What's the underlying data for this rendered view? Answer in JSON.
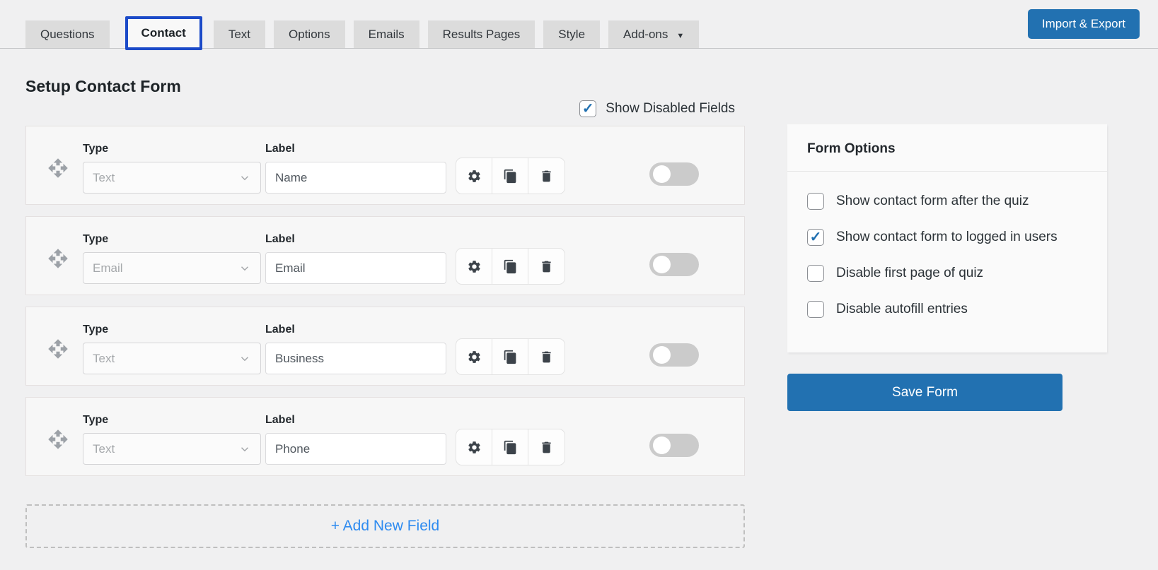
{
  "tabs": {
    "items": [
      {
        "label": "Questions",
        "active": false,
        "has_dropdown": false
      },
      {
        "label": "Contact",
        "active": true,
        "has_dropdown": false
      },
      {
        "label": "Text",
        "active": false,
        "has_dropdown": false
      },
      {
        "label": "Options",
        "active": false,
        "has_dropdown": false
      },
      {
        "label": "Emails",
        "active": false,
        "has_dropdown": false
      },
      {
        "label": "Results Pages",
        "active": false,
        "has_dropdown": false
      },
      {
        "label": "Style",
        "active": false,
        "has_dropdown": false
      },
      {
        "label": "Add-ons",
        "active": false,
        "has_dropdown": true
      }
    ],
    "import_export_label": "Import & Export"
  },
  "header": {
    "title": "Setup Contact Form",
    "show_disabled_label": "Show Disabled Fields",
    "show_disabled_checked": true
  },
  "fields": {
    "type_column_label": "Type",
    "label_column_label": "Label",
    "rows": [
      {
        "type": "Text",
        "label": "Name",
        "enabled": false
      },
      {
        "type": "Email",
        "label": "Email",
        "enabled": false
      },
      {
        "type": "Text",
        "label": "Business",
        "enabled": false
      },
      {
        "type": "Text",
        "label": "Phone",
        "enabled": false
      }
    ],
    "add_new_label": "+ Add New Field"
  },
  "form_options": {
    "title": "Form Options",
    "options": [
      {
        "label": "Show contact form after the quiz",
        "checked": false
      },
      {
        "label": "Show contact form to logged in users",
        "checked": true
      },
      {
        "label": "Disable first page of quiz",
        "checked": false
      },
      {
        "label": "Disable autofill entries",
        "checked": false
      }
    ],
    "save_label": "Save Form"
  },
  "icons": {
    "drag": "move-icon",
    "settings": "gear-icon",
    "duplicate": "copy-icon",
    "delete": "trash-icon",
    "select_arrow": "chevron-down-icon",
    "addons_arrow": "caret-down-icon",
    "checkbox_mark": "check-icon"
  },
  "colors": {
    "accent_blue": "#2271b1",
    "active_tab_border": "#1b4ac8",
    "add_field_link": "#2e8bf0",
    "toggle_off": "#cbcbcb",
    "page_background": "#f0f0f1",
    "tab_background": "#dcdcdc"
  }
}
